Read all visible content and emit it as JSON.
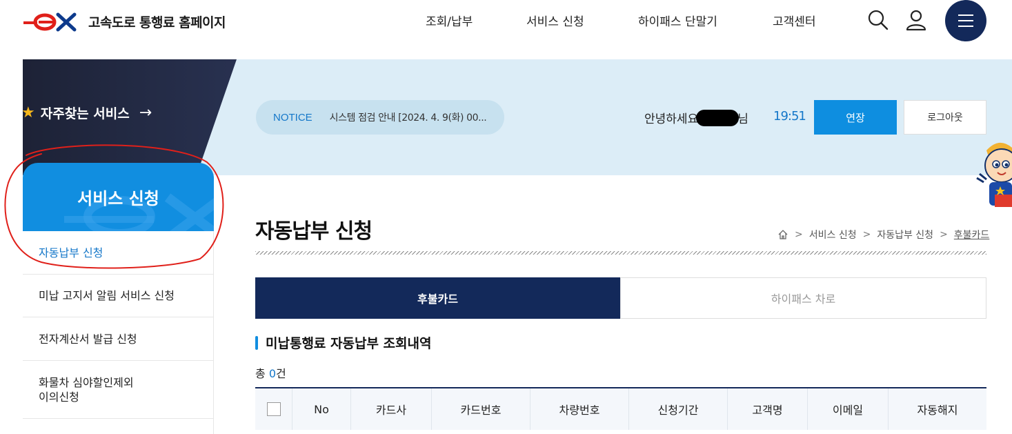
{
  "header": {
    "logo_text": "고속도로 통행료 홈페이지",
    "nav": [
      "조회/납부",
      "서비스 신청",
      "하이패스 단말기",
      "고객센터"
    ],
    "icons": [
      "search-icon",
      "user-icon",
      "menu-icon"
    ]
  },
  "favorites": {
    "label": "자주찾는 서비스",
    "arrow": "→"
  },
  "banner": {
    "notice_tag": "NOTICE",
    "notice_text": "시스템 점검 안내 [2024. 4. 9(화) 00...",
    "greeting_prefix": "안녕하세요",
    "greeting_suffix": "님",
    "timer": "19:51",
    "extend_label": "연장",
    "logout_label": "로그아웃"
  },
  "sidebar": {
    "title": "서비스 신청",
    "items": [
      {
        "label": "자동납부 신청",
        "active": true
      },
      {
        "label": "미납 고지서 알림 서비스 신청"
      },
      {
        "label": "전자계산서 발급 신청"
      },
      {
        "label": "화물차 심야할인제외\n이의신청"
      },
      {
        "label": ""
      }
    ]
  },
  "page": {
    "title": "자동납부 신청",
    "breadcrumb": [
      "서비스 신청",
      "자동납부 신청",
      "후불카드"
    ]
  },
  "tabs": [
    {
      "label": "후불카드",
      "active": true
    },
    {
      "label": "하이패스 차로",
      "active": false
    }
  ],
  "section": {
    "title": "미납통행료 자동납부 조회내역",
    "total_prefix": "총 ",
    "total_count": "0",
    "total_suffix": "건"
  },
  "table": {
    "columns": [
      "No",
      "카드사",
      "카드번호",
      "차량번호",
      "신청기간",
      "고객명",
      "이메일",
      "자동해지"
    ]
  },
  "colors": {
    "navy": "#13295a",
    "blue": "#118ee0",
    "link_blue": "#1477c9",
    "banner_bg": "#dcedf7",
    "annotation_red": "#e0201a"
  }
}
